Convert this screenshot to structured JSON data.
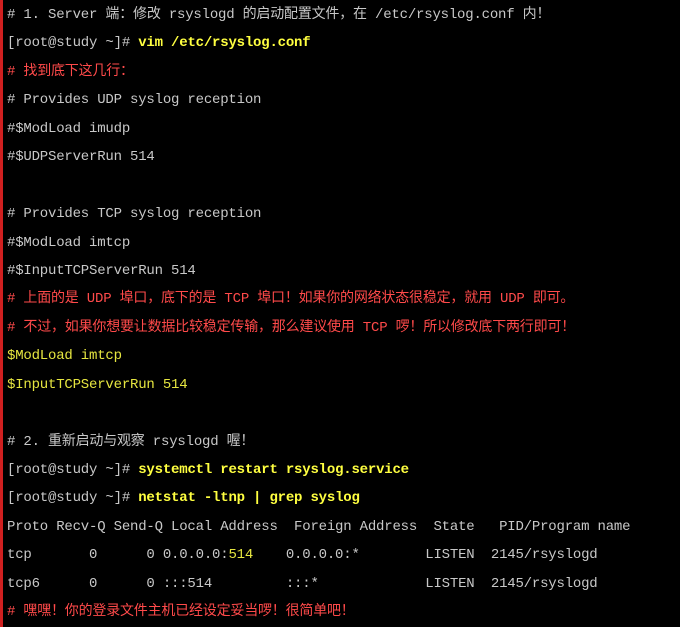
{
  "colors": {
    "background": "#000000",
    "gray": "#c8c8c8",
    "red": "#ff4a4a",
    "yellow": "#ffff40",
    "dimyellow": "#e6e640",
    "border": "#d02020"
  },
  "lines": [
    [
      {
        "t": "# 1. Server 端：修改 rsyslogd 的启动配置文件，在 /etc/rsyslog.conf 内！",
        "c": "gray"
      }
    ],
    [
      {
        "t": "[root@study ~]# ",
        "c": "gray"
      },
      {
        "t": "vim /etc/rsyslog.conf",
        "c": "yellow"
      }
    ],
    [
      {
        "t": "# 找到底下这几行：",
        "c": "red"
      }
    ],
    [
      {
        "t": "# Provides UDP syslog reception",
        "c": "gray"
      }
    ],
    [
      {
        "t": "#$ModLoad imudp",
        "c": "gray"
      }
    ],
    [
      {
        "t": "#$UDPServerRun 514",
        "c": "gray"
      }
    ],
    [
      {
        "t": "",
        "c": "gray"
      }
    ],
    [
      {
        "t": "# Provides TCP syslog reception",
        "c": "gray"
      }
    ],
    [
      {
        "t": "#$ModLoad imtcp",
        "c": "gray"
      }
    ],
    [
      {
        "t": "#$InputTCPServerRun 514",
        "c": "gray"
      }
    ],
    [
      {
        "t": "# 上面的是 UDP 埠口，底下的是 TCP 埠口！如果你的网络状态很稳定，就用 UDP 即可。",
        "c": "red"
      }
    ],
    [
      {
        "t": "# 不过，如果你想要让数据比较稳定传输，那么建议使用 TCP 啰！所以修改底下两行即可！",
        "c": "red"
      }
    ],
    [
      {
        "t": "$ModLoad imtcp",
        "c": "dimyellow"
      }
    ],
    [
      {
        "t": "$InputTCPServerRun 514",
        "c": "dimyellow"
      }
    ],
    [
      {
        "t": "",
        "c": "gray"
      }
    ],
    [
      {
        "t": "# 2. 重新启动与观察 rsyslogd 喔！",
        "c": "gray"
      }
    ],
    [
      {
        "t": "[root@study ~]# ",
        "c": "gray"
      },
      {
        "t": "systemctl restart rsyslog.service",
        "c": "yellow"
      }
    ],
    [
      {
        "t": "[root@study ~]# ",
        "c": "gray"
      },
      {
        "t": "netstat -ltnp | grep syslog",
        "c": "yellow"
      }
    ],
    [
      {
        "t": "Proto Recv-Q Send-Q Local Address  Foreign Address  State   PID/Program name",
        "c": "gray"
      }
    ],
    [
      {
        "t": "tcp       0      0 0.0.0.0:",
        "c": "gray"
      },
      {
        "t": "514",
        "c": "dimyellow"
      },
      {
        "t": "    0.0.0.0:*        LISTEN  2145/rsyslogd",
        "c": "gray"
      }
    ],
    [
      {
        "t": "tcp6      0      0 :::514         :::*             LISTEN  2145/rsyslogd",
        "c": "gray"
      }
    ],
    [
      {
        "t": "# 嘿嘿！你的登录文件主机已经设定妥当啰！很简单吧！",
        "c": "red"
      }
    ]
  ]
}
